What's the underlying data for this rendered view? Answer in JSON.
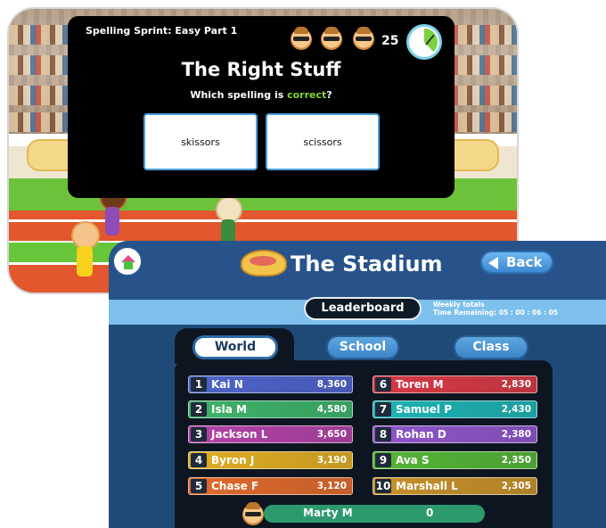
{
  "game": {
    "title": "Spelling Sprint: Easy Part 1",
    "count": "25",
    "heading": "The Right Stuff",
    "prompt_before": "Which spelling is ",
    "prompt_highlight": "correct",
    "prompt_after": "?",
    "answers": [
      "skissors",
      "scissors"
    ],
    "highlight_color": "#7fd82c"
  },
  "stadium": {
    "title": "The Stadium",
    "back_label": "Back",
    "leaderboard_label": "Leaderboard",
    "weekly_line1": "Weekly totals",
    "weekly_line2": "Time Remaining: 05 : 00 : 06 : 05",
    "tabs": [
      "World",
      "School",
      "Class"
    ],
    "active_tab": "World",
    "ranks": [
      {
        "rank": "1",
        "name": "Kai N",
        "score": "8,360",
        "color": "#4f63c9"
      },
      {
        "rank": "2",
        "name": "Isla M",
        "score": "4,580",
        "color": "#3fb36a"
      },
      {
        "rank": "3",
        "name": "Jackson L",
        "score": "3,650",
        "color": "#b343a6"
      },
      {
        "rank": "4",
        "name": "Byron J",
        "score": "3,190",
        "color": "#e0ad23"
      },
      {
        "rank": "5",
        "name": "Chase F",
        "score": "3,120",
        "color": "#e06a2c"
      },
      {
        "rank": "6",
        "name": "Toren M",
        "score": "2,830",
        "color": "#d63a45"
      },
      {
        "rank": "7",
        "name": "Samuel P",
        "score": "2,430",
        "color": "#1fb3b3"
      },
      {
        "rank": "8",
        "name": "Rohan D",
        "score": "2,380",
        "color": "#8f56c9"
      },
      {
        "rank": "9",
        "name": "Ava S",
        "score": "2,350",
        "color": "#55b536"
      },
      {
        "rank": "10",
        "name": "Marshall L",
        "score": "2,305",
        "color": "#c7922a"
      }
    ],
    "me": {
      "name": "Marty M",
      "score": "0"
    }
  }
}
